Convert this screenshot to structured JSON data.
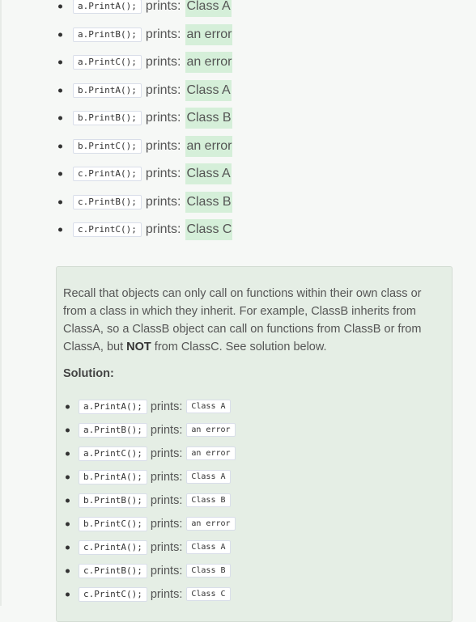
{
  "prints_label": "prints:",
  "answers": [
    {
      "code": "a.PrintA();",
      "value": "Class A"
    },
    {
      "code": "a.PrintB();",
      "value": "an error"
    },
    {
      "code": "a.PrintC();",
      "value": "an error"
    },
    {
      "code": "b.PrintA();",
      "value": "Class A"
    },
    {
      "code": "b.PrintB();",
      "value": "Class B"
    },
    {
      "code": "b.PrintC();",
      "value": "an error"
    },
    {
      "code": "c.PrintA();",
      "value": "Class A"
    },
    {
      "code": "c.PrintB();",
      "value": "Class B"
    },
    {
      "code": "c.PrintC();",
      "value": "Class C"
    }
  ],
  "explanation": {
    "before_bold": "Recall that objects can only call on functions within their own class or from a class in which they inherit. For example, ClassB inherits from ClassA, so a ClassB object can call on functions from ClassB or from ClassA, but ",
    "bold": "NOT",
    "after_bold": " from ClassC. See solution below."
  },
  "solution_heading": "Solution:",
  "solution": [
    {
      "code": "a.PrintA();",
      "value": "Class A"
    },
    {
      "code": "a.PrintB();",
      "value": "an error"
    },
    {
      "code": "a.PrintC();",
      "value": "an error"
    },
    {
      "code": "b.PrintA();",
      "value": "Class A"
    },
    {
      "code": "b.PrintB();",
      "value": "Class B"
    },
    {
      "code": "b.PrintC();",
      "value": "an error"
    },
    {
      "code": "c.PrintA();",
      "value": "Class A"
    },
    {
      "code": "c.PrintB();",
      "value": "Class B"
    },
    {
      "code": "c.PrintC();",
      "value": "Class C"
    }
  ],
  "colors": {
    "answer_highlight": "#d5efd9",
    "solution_bg": "#e5eee5"
  }
}
